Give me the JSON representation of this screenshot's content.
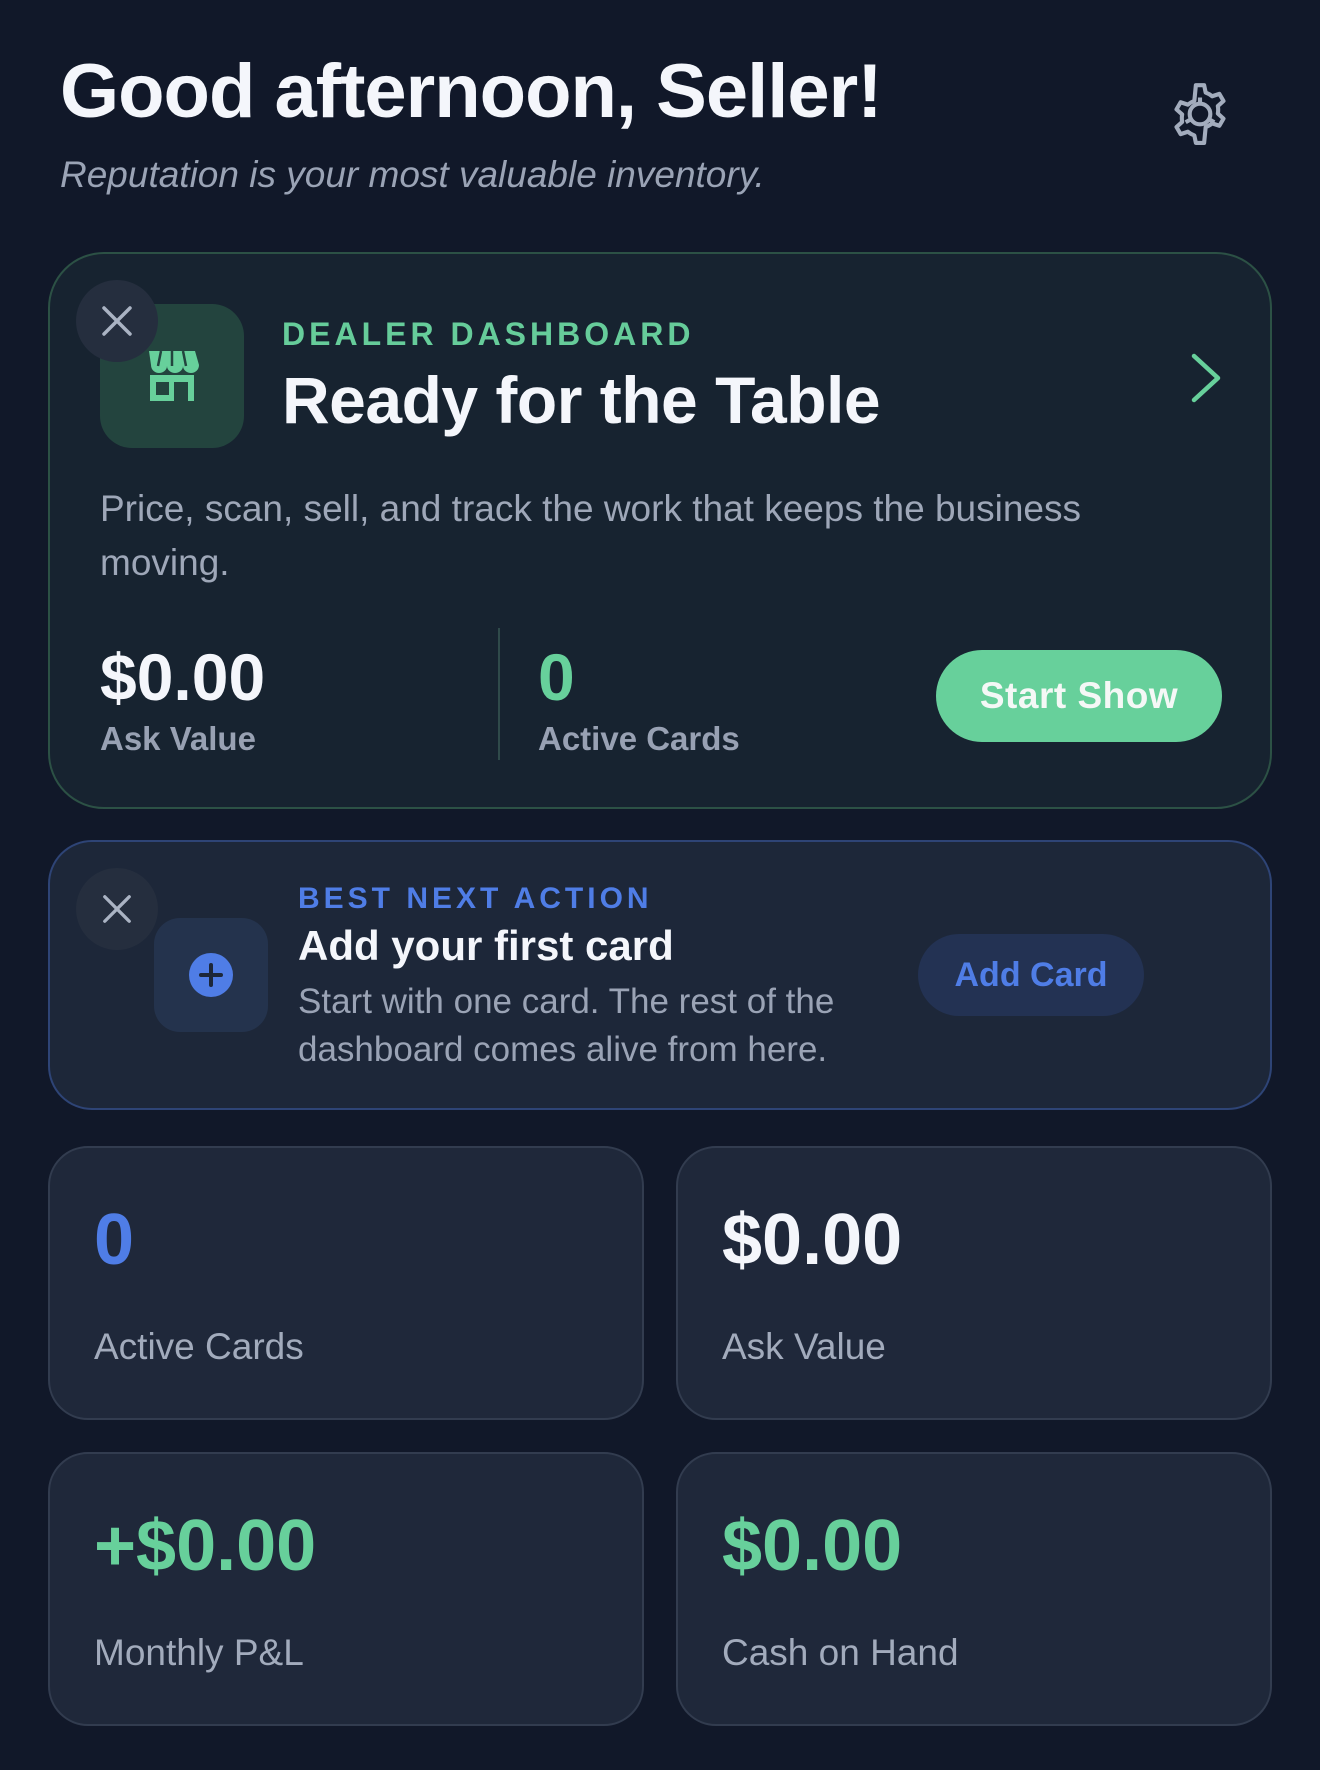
{
  "header": {
    "greeting": "Good afternoon, Seller!",
    "tagline": "Reputation is your most valuable inventory.",
    "settings_icon": "gear-icon"
  },
  "hero": {
    "kicker": "DEALER DASHBOARD",
    "title": "Ready for the Table",
    "description": "Price, scan, sell, and track the work that keeps the business moving.",
    "stats": [
      {
        "value": "$0.00",
        "label": "Ask Value"
      },
      {
        "value": "0",
        "label": "Active Cards"
      }
    ],
    "cta_label": "Start Show",
    "icon": "storefront-icon"
  },
  "next_action": {
    "kicker": "BEST NEXT ACTION",
    "title": "Add your first card",
    "description": "Start with one card. The rest of the dashboard comes alive from here.",
    "cta_label": "Add Card",
    "icon": "plus-circle-icon"
  },
  "tiles": [
    {
      "value": "0",
      "label": "Active Cards",
      "color": "#4f7de6"
    },
    {
      "value": "$0.00",
      "label": "Ask Value",
      "color": "#f4f6fb"
    },
    {
      "value": "+$0.00",
      "label": "Monthly P&L",
      "color": "#67d09b"
    },
    {
      "value": "$0.00",
      "label": "Cash on Hand",
      "color": "#67d09b"
    }
  ],
  "colors": {
    "background": "#111829",
    "accent_green": "#67d09b",
    "accent_blue": "#4f7de6"
  }
}
